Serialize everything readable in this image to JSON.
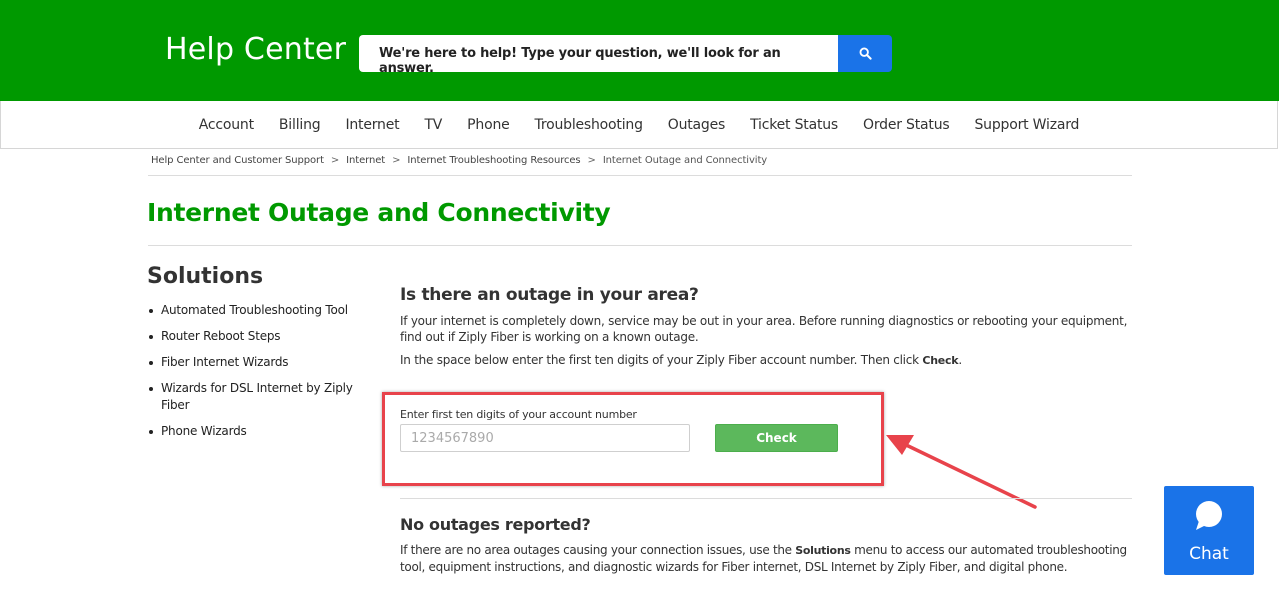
{
  "header": {
    "title": "Help Center",
    "search_placeholder": "We're here to help! Type your question, we'll look for an answer."
  },
  "nav": {
    "items": [
      "Account",
      "Billing",
      "Internet",
      "TV",
      "Phone",
      "Troubleshooting",
      "Outages",
      "Ticket Status",
      "Order Status",
      "Support Wizard"
    ]
  },
  "breadcrumb": {
    "items": [
      "Help Center and Customer Support",
      "Internet",
      "Internet Troubleshooting Resources",
      "Internet Outage and Connectivity"
    ],
    "separator": ">"
  },
  "page": {
    "title": "Internet Outage and Connectivity"
  },
  "sidebar": {
    "heading": "Solutions",
    "items": [
      "Automated Troubleshooting Tool",
      "Router Reboot Steps",
      "Fiber Internet Wizards",
      "Wizards for DSL Internet by Ziply Fiber",
      "Phone Wizards"
    ]
  },
  "outage": {
    "heading": "Is there an outage in your area?",
    "paragraph1": "If your internet is completely down, service may be out in your area.  Before running diagnostics or rebooting your equipment, find out if Ziply Fiber is working on a known outage.",
    "paragraph2_prefix": "In the space below enter the first ten digits of your Ziply Fiber account number. Then click ",
    "paragraph2_bold": "Check",
    "paragraph2_suffix": ".",
    "input_label": "Enter first ten digits of your account number",
    "input_placeholder": "1234567890",
    "check_label": "Check"
  },
  "no_outage": {
    "heading": "No outages reported?",
    "paragraph_prefix": "If there are no area outages causing your connection issues, use the ",
    "paragraph_bold": "Solutions",
    "paragraph_suffix": " menu to access our automated troubleshooting tool, equipment instructions, and diagnostic wizards for Fiber internet, DSL Internet by Ziply Fiber, and digital phone."
  },
  "chat": {
    "label": "Chat"
  },
  "colors": {
    "brand_green": "#009900",
    "search_blue": "#1a73e8",
    "check_green": "#5cb85c",
    "annotation_red": "#e8434b"
  },
  "icons": {
    "search": "search-icon",
    "chat": "chat-bubble-icon"
  }
}
